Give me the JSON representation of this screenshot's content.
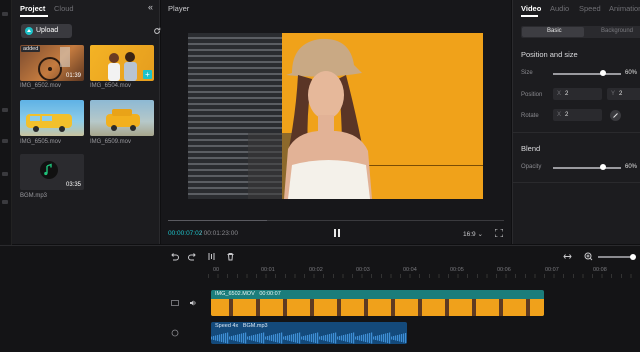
{
  "project_panel": {
    "tabs": [
      {
        "label": "Project"
      },
      {
        "label": "Cloud"
      }
    ],
    "upload_label": "Upload",
    "media": [
      {
        "name": "IMG_6502.mov",
        "duration": "01:39",
        "badge": "added"
      },
      {
        "name": "IMG_6504.mov",
        "duration": "",
        "badge": ""
      },
      {
        "name": "IMG_6505.mov",
        "duration": "",
        "badge": ""
      },
      {
        "name": "IMG_6509.mov",
        "duration": "",
        "badge": ""
      },
      {
        "name": "BGM.mp3",
        "duration": "03:35",
        "badge": ""
      }
    ]
  },
  "player": {
    "title": "Player",
    "current_time": "00:00:07:02",
    "total_time": "/ 00:01:23:00",
    "aspect_ratio": "16:9",
    "progress": 0.29
  },
  "inspector": {
    "tabs": [
      {
        "label": "Video"
      },
      {
        "label": "Audio"
      },
      {
        "label": "Speed"
      },
      {
        "label": "Animation"
      }
    ],
    "subtabs": [
      {
        "label": "Basic"
      },
      {
        "label": "Background"
      }
    ],
    "position_section": "Position and size",
    "size_label": "Size",
    "size_value": "60%",
    "size_level": 0.74,
    "position_label": "Position",
    "pos_x_axis": "X",
    "pos_x": "2",
    "pos_y_axis": "Y",
    "pos_y": "2",
    "rotate_label": "Rotate",
    "rotate_axis": "X",
    "rotate_value": "2",
    "blend_section": "Blend",
    "opacity_label": "Opacity",
    "opacity_value": "60%",
    "opacity_level": 0.74
  },
  "timeline": {
    "ticks": [
      "00",
      "00:01",
      "00:02",
      "00:03",
      "00:04",
      "00:05",
      "00:06",
      "00:07",
      "00:08"
    ],
    "video_clip": {
      "name": "IMG_6502.MOV",
      "time": "00:00:07"
    },
    "audio_clip": {
      "speed": "Speed 4x",
      "name": "BGM.mp3"
    }
  },
  "colors": {
    "accent": "#1ec2c9",
    "video_clip": "#1b7d7b",
    "audio_clip": "#144a7b",
    "frame_bg": "#f0a21a"
  }
}
